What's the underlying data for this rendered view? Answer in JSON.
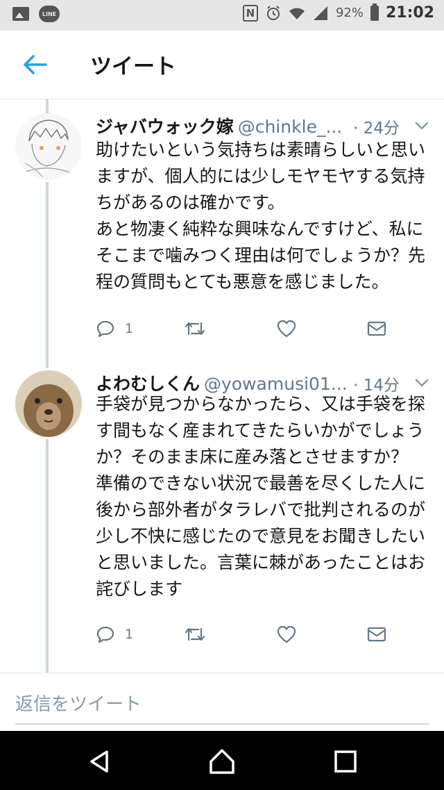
{
  "status_bar": {
    "line_label": "LINE",
    "battery": "92%",
    "time": "21:02"
  },
  "header": {
    "title": "ツイート"
  },
  "tweets": [
    {
      "name": "ジャバウォック嫁",
      "handle": "@chinkle_...",
      "time": "· 24分",
      "body": "助けたいという気持ちは素晴らしいと思いますが、個人的には少しモヤモヤする気持ちがあるのは確かです。\nあと物凄く純粋な興味なんですけど、私にそこまで噛みつく理由は何でしょうか？先程の質問もとても悪意を感じました。",
      "reply_count": "1"
    },
    {
      "name": "よわむしくん",
      "handle": "@yowamusi01...",
      "time": "· 14分",
      "body": "手袋が見つからなかったら、又は手袋を探す間もなく産まれてきたらいかがでしょうか？そのまま床に産み落とさせますか？\n準備のできない状況で最善を尽くした人に後から部外者がタラレバで批判されるのが少し不快に感じたので意見をお聞きしたいと思いました。言葉に棘があったことはお詫びします",
      "reply_count": "1"
    }
  ],
  "reply": {
    "placeholder": "返信をツイート"
  },
  "colors": {
    "accent": "#1da1f2",
    "muted": "#657786",
    "thread": "#ccd6dd"
  }
}
